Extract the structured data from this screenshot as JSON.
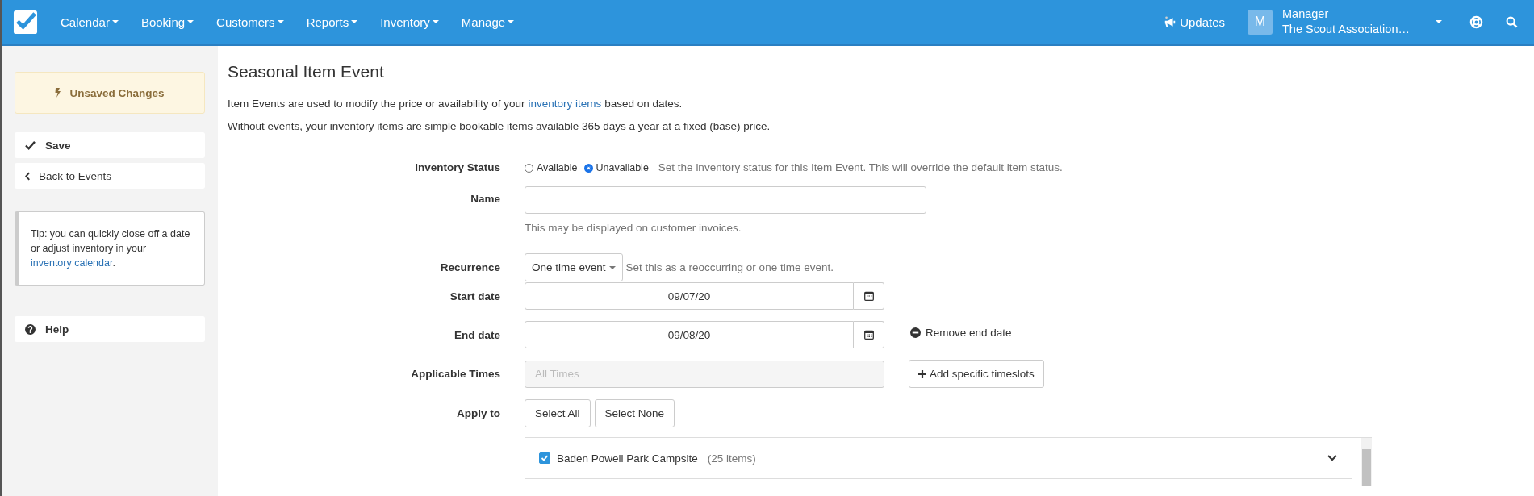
{
  "nav": {
    "menus": [
      {
        "label": "Calendar"
      },
      {
        "label": "Booking"
      },
      {
        "label": "Customers"
      },
      {
        "label": "Reports"
      },
      {
        "label": "Inventory"
      },
      {
        "label": "Manage"
      }
    ],
    "updates": {
      "label": "Updates"
    },
    "user": {
      "initial": "M",
      "role": "Manager",
      "org": "The Scout Association…"
    }
  },
  "sidebar": {
    "unsaved": "Unsaved Changes",
    "save": "Save",
    "back": "Back to Events",
    "tip": {
      "text": "Tip: you can quickly close off a date or adjust inventory in your",
      "link": "inventory calendar",
      "after": "."
    },
    "help": "Help"
  },
  "page": {
    "title": "Seasonal Item Event",
    "intro": [
      {
        "before": "Item Events are used to modify the price or availability of your",
        "link": "inventory items",
        "after": "based on dates."
      },
      {
        "before": "Without events, your inventory items are simple bookable items available 365 days a year at a fixed (base) price."
      }
    ]
  },
  "form": {
    "inventory_status": {
      "label": "Inventory Status",
      "options": [
        {
          "label": "Available",
          "selected": false
        },
        {
          "label": "Unavailable",
          "selected": true
        }
      ],
      "hint": "Set the inventory status for this Item Event. This will override the default item status."
    },
    "name": {
      "label": "Name",
      "help": "This may be displayed on customer invoices."
    },
    "recurrence": {
      "label": "Recurrence",
      "value": "One time event",
      "hint": "Set this as a reoccurring or one time event."
    },
    "start_date": {
      "label": "Start date",
      "value": "09/07/20"
    },
    "end_date": {
      "label": "End date",
      "value": "09/08/20",
      "action": "Remove end date"
    },
    "applicable_times": {
      "label": "Applicable Times",
      "placeholder": "All Times",
      "button": "Add specific timeslots"
    },
    "apply_to": {
      "label": "Apply to",
      "buttons": [
        "Select All",
        "Select None"
      ],
      "locations": [
        {
          "name": "Baden Powell Park Campsite",
          "count": "(25 items)",
          "checked": true
        }
      ]
    }
  }
}
